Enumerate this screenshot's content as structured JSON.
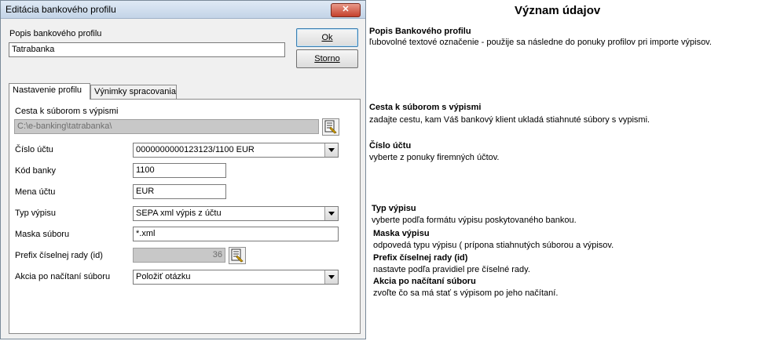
{
  "dialog": {
    "title": "Editácia bankového profilu",
    "close_label": "✕",
    "profile_desc_label": "Popis bankového profilu",
    "profile_desc_value": "Tatrabanka",
    "ok_label": "Ok",
    "cancel_label": "Storno",
    "tabs": [
      {
        "label": "Nastavenie profilu"
      },
      {
        "label": "Výnimky spracovania"
      }
    ],
    "path_label": "Cesta k súborom s výpismi",
    "path_value": "C:\\e-banking\\tatrabanka\\",
    "account_label": "Číslo účtu",
    "account_value": "0000000000123123/1100  EUR",
    "bank_code_label": "Kód banky",
    "bank_code_value": "1100",
    "currency_label": "Mena účtu",
    "currency_value": "EUR",
    "statement_type_label": "Typ výpisu",
    "statement_type_value": "SEPA xml výpis z účtu",
    "file_mask_label": "Maska súboru",
    "file_mask_value": "*.xml",
    "prefix_label": "Prefix číselnej rady (id)",
    "prefix_value": "36",
    "action_label": "Akcia po načítaní súboru",
    "action_value": "Položiť otázku"
  },
  "help": {
    "title": "Význam údajov",
    "items": [
      {
        "heading": "Popis Bankového profilu",
        "text": "ľubovolné textové označenie - použije sa následne do ponuky profilov pri importe výpisov."
      },
      {
        "heading": "Cesta k súborom s výpismi",
        "text": "zadajte cestu, kam Váš bankový klient ukladá stiahnuté súbory s vypismi."
      },
      {
        "heading": "Číslo účtu",
        "text": "vyberte z ponuky firemných účtov."
      },
      {
        "heading": "Typ výpisu",
        "text": "vyberte podľa formátu výpisu poskytovaného bankou."
      },
      {
        "heading": "Maska výpisu",
        "text": "odpovedá typu výpisu ( prípona stiahnutých súborou a výpisov."
      },
      {
        "heading": "Prefix číselnej rady (id)",
        "text": "nastavte podľa pravidiel pre číselné rady."
      },
      {
        "heading": "Akcia po načítaní súboru",
        "text": "zvoľte čo sa má stať s výpisom po jeho načítaní."
      }
    ]
  }
}
